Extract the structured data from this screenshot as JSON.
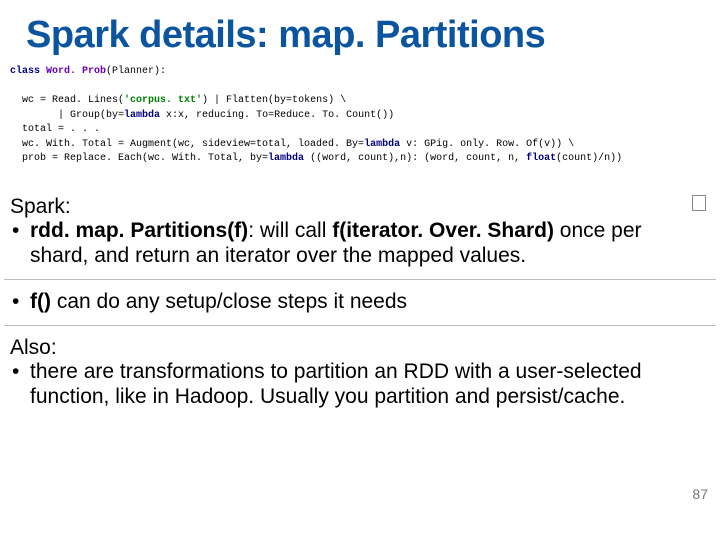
{
  "title": "Spark details: map. Partitions",
  "code": {
    "l1_kw": "class",
    "l1_cls": "Word. Prob",
    "l1_rest": "(Planner):",
    "l3_pre": "  wc = Read. Lines(",
    "l3_str": "'corpus. txt'",
    "l3_post": ") | Flatten(by=tokens) \\",
    "l4_pre": "        | Group(by=",
    "l4_lam": "lambda",
    "l4_post": " x:x, reducing. To=Reduce. To. Count())",
    "l5": "  total = . . .",
    "l6_pre": "  wc. With. Total = Augment(wc, sideview=total, loaded. By=",
    "l6_lam": "lambda",
    "l6_post": " v: GPig. only. Row. Of(v)) \\",
    "l7_pre": "  prob = Replace. Each(wc. With. Total, by=",
    "l7_lam": "lambda",
    "l7_mid": " ((word, count),n): (word, count, n, ",
    "l7_float": "float",
    "l7_post": "(count)/n))"
  },
  "body": {
    "spark_label": "Spark:",
    "b1_pre": "rdd. map. Partitions(f)",
    "b1_mid": ":  will call ",
    "b1_bold2": "f(iterator. Over. Shard)",
    "b1_post": " once per shard, and return an iterator over the mapped values.",
    "b2_pre": "f()",
    "b2_post": " can do any setup/close steps it needs",
    "also_label": "Also:",
    "b3": "there are transformations to partition an RDD with a user-selected function, like in Hadoop.  Usually you partition and persist/cache."
  },
  "page_number": "87"
}
